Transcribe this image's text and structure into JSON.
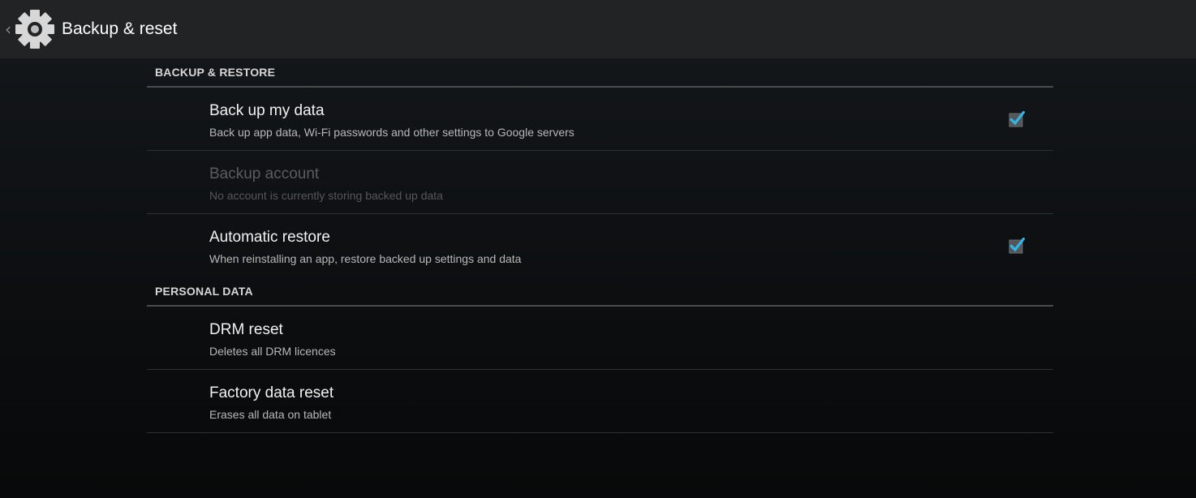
{
  "action_bar": {
    "title": "Backup & reset",
    "up_icon": "chevron-left-icon",
    "app_icon": "gear-icon"
  },
  "sections": {
    "backup_restore": {
      "header": "BACKUP & RESTORE",
      "items": {
        "backup_data": {
          "title": "Back up my data",
          "summary": "Back up app data, Wi-Fi passwords and other settings to Google servers",
          "checked": true
        },
        "backup_account": {
          "title": "Backup account",
          "summary": "No account is currently storing backed up data",
          "enabled": false
        },
        "auto_restore": {
          "title": "Automatic restore",
          "summary": "When reinstalling an app, restore backed up settings and data",
          "checked": true
        }
      }
    },
    "personal_data": {
      "header": "PERSONAL DATA",
      "items": {
        "drm_reset": {
          "title": "DRM reset",
          "summary": "Deletes all DRM licences"
        },
        "factory_reset": {
          "title": "Factory data reset",
          "summary": "Erases all data on tablet"
        }
      }
    }
  },
  "colors": {
    "accent": "#33b5e5",
    "action_bar": "#222324",
    "divider": "#4a4d50"
  }
}
